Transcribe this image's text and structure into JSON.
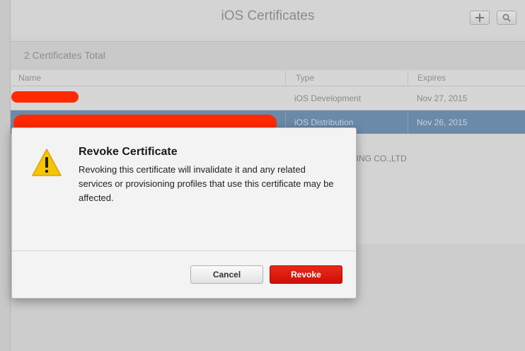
{
  "window": {
    "title": "iOS Certificates"
  },
  "toolbar": {
    "add_icon": "plus-icon",
    "search_icon": "search-icon"
  },
  "summary": {
    "total": "2 Certificates Total"
  },
  "table": {
    "columns": [
      "Name",
      "Type",
      "Expires"
    ],
    "rows": [
      {
        "type": "iOS Development",
        "expires": "Nov 27, 2015",
        "selected": false
      },
      {
        "type": "iOS Distribution",
        "expires": "Nov 26, 2015",
        "selected": true
      }
    ],
    "detail_fragment": "TTING CO.,LTD"
  },
  "dialog": {
    "icon": "warning-icon",
    "title": "Revoke Certificate",
    "message": "Revoking this certificate will invalidate it and any related services or provisioning profiles that use this certificate may be affected.",
    "cancel_label": "Cancel",
    "revoke_label": "Revoke"
  },
  "colors": {
    "accent_red": "#d00f06",
    "selected_row": "#6b89a8",
    "redaction": "#ff2a00"
  }
}
